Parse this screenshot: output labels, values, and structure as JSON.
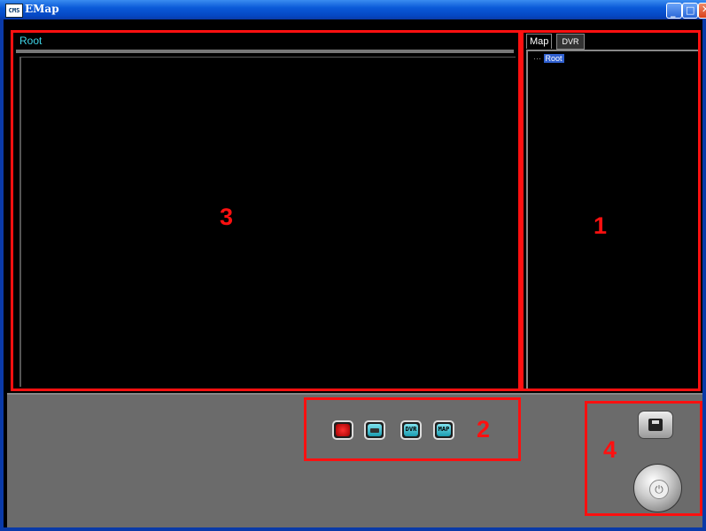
{
  "window": {
    "title": "EMap",
    "app_icon_label": "CMS"
  },
  "map_view": {
    "path": "Root"
  },
  "tabs": [
    {
      "label": "Map"
    },
    {
      "label": "DVR"
    }
  ],
  "tree": {
    "nodes": [
      {
        "label": "Root",
        "selected": true
      }
    ]
  },
  "toolbar": {
    "buttons": [
      {
        "icon": "alarm-bell-icon",
        "label": ""
      },
      {
        "icon": "camera-icon",
        "label": ""
      },
      {
        "icon": "dvr-icon",
        "label": "DVR"
      },
      {
        "icon": "map-icon",
        "label": "MAP"
      }
    ]
  },
  "callouts": {
    "panel_tree": "1",
    "toolbar": "2",
    "map_view": "3",
    "controls": "4"
  },
  "colors": {
    "highlight": "#ff1010",
    "path_text": "#3fd5e8",
    "selection": "#3060d0"
  }
}
